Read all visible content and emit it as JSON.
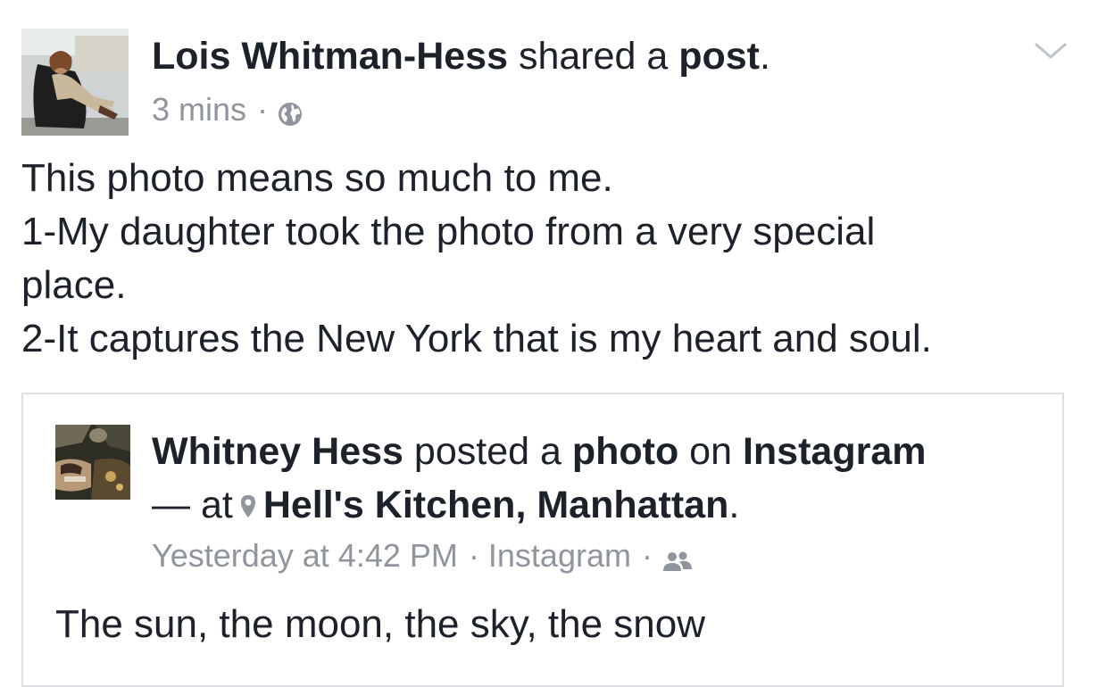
{
  "post": {
    "author": "Lois Whitman-Hess",
    "action_text": " shared a ",
    "object_text": "post",
    "period": ".",
    "timestamp": "3 mins",
    "separator": "·",
    "privacy_icon": "globe-icon",
    "menu_icon": "chevron-down-icon",
    "body_lines": [
      "This photo means so much to me.",
      "1-My daughter took the photo from a very special",
      "place.",
      "2-It captures the New York that is my heart and soul."
    ]
  },
  "shared": {
    "author": "Whitney Hess",
    "action_text": " posted a ",
    "object_text": "photo",
    "on_text": " on ",
    "platform": "Instagram",
    "at_text": "— at",
    "location_icon": "map-pin-icon",
    "location": "Hell's Kitchen, Manhattan",
    "period": ".",
    "timestamp": "Yesterday at 4:42 PM",
    "separator": "·",
    "source": "Instagram",
    "audience_icon": "friends-icon",
    "caption": "The sun, the moon, the sky, the snow"
  },
  "colors": {
    "text": "#1d2129",
    "meta": "#90949c",
    "border": "#dddfe2"
  }
}
